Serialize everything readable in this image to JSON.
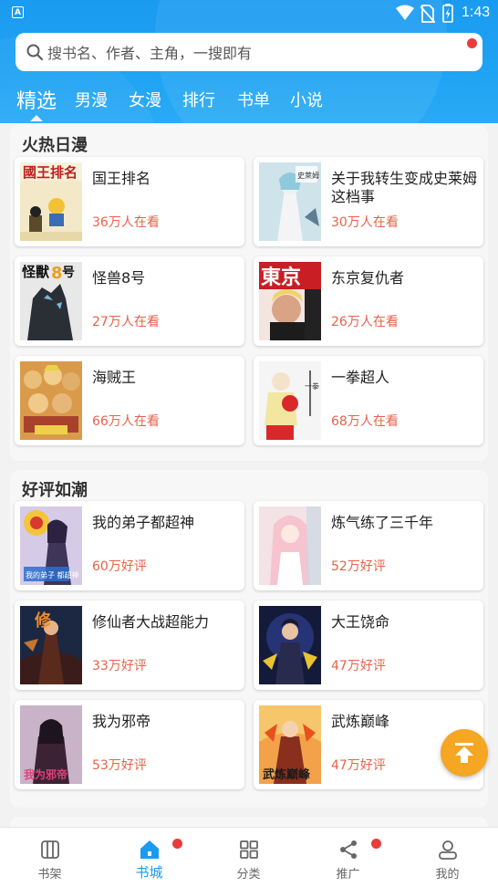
{
  "status_bar": {
    "time": "1:43",
    "app_icon": "A"
  },
  "search": {
    "placeholder": "搜书名、作者、主角，一搜即有"
  },
  "tabs": [
    {
      "label": "精选",
      "active": true
    },
    {
      "label": "男漫"
    },
    {
      "label": "女漫"
    },
    {
      "label": "排行"
    },
    {
      "label": "书单"
    },
    {
      "label": "小说"
    }
  ],
  "sections": [
    {
      "title": "火热日漫",
      "items": [
        {
          "title": "国王排名",
          "meta": "36万人在看",
          "cover_text": "國王排名"
        },
        {
          "title": "关于我转生变成史莱姆这档事",
          "meta": "30万人在看",
          "cover_text": "史萊姆"
        },
        {
          "title": "怪兽8号",
          "meta": "27万人在看",
          "cover_text": "怪獸8号"
        },
        {
          "title": "东京复仇者",
          "meta": "26万人在看",
          "cover_text": "東京"
        },
        {
          "title": "海贼王",
          "meta": "66万人在看",
          "cover_text": ""
        },
        {
          "title": "一拳超人",
          "meta": "68万人在看",
          "cover_text": ""
        }
      ]
    },
    {
      "title": "好评如潮",
      "items": [
        {
          "title": "我的弟子都超神",
          "meta": "60万好评",
          "cover_text": "我的弟子 都超神"
        },
        {
          "title": "炼气练了三千年",
          "meta": "52万好评",
          "cover_text": ""
        },
        {
          "title": "修仙者大战超能力",
          "meta": "33万好评",
          "cover_text": ""
        },
        {
          "title": "大王饶命",
          "meta": "47万好评",
          "cover_text": ""
        },
        {
          "title": "我为邪帝",
          "meta": "53万好评",
          "cover_text": "我为邪帝"
        },
        {
          "title": "武炼巅峰",
          "meta": "47万好评",
          "cover_text": "武炼巅峰"
        }
      ]
    }
  ],
  "bottom_nav": [
    {
      "label": "书架",
      "icon": "bookshelf-icon"
    },
    {
      "label": "书城",
      "icon": "home-icon",
      "active": true,
      "badge": true
    },
    {
      "label": "分类",
      "icon": "category-icon"
    },
    {
      "label": "推广",
      "icon": "share-icon",
      "badge": true
    },
    {
      "label": "我的",
      "icon": "profile-icon"
    }
  ],
  "colors": {
    "accent": "#1a9bf0",
    "meta_text": "#e8624a",
    "badge": "#ea3b3b",
    "fab": "#f5a623"
  }
}
